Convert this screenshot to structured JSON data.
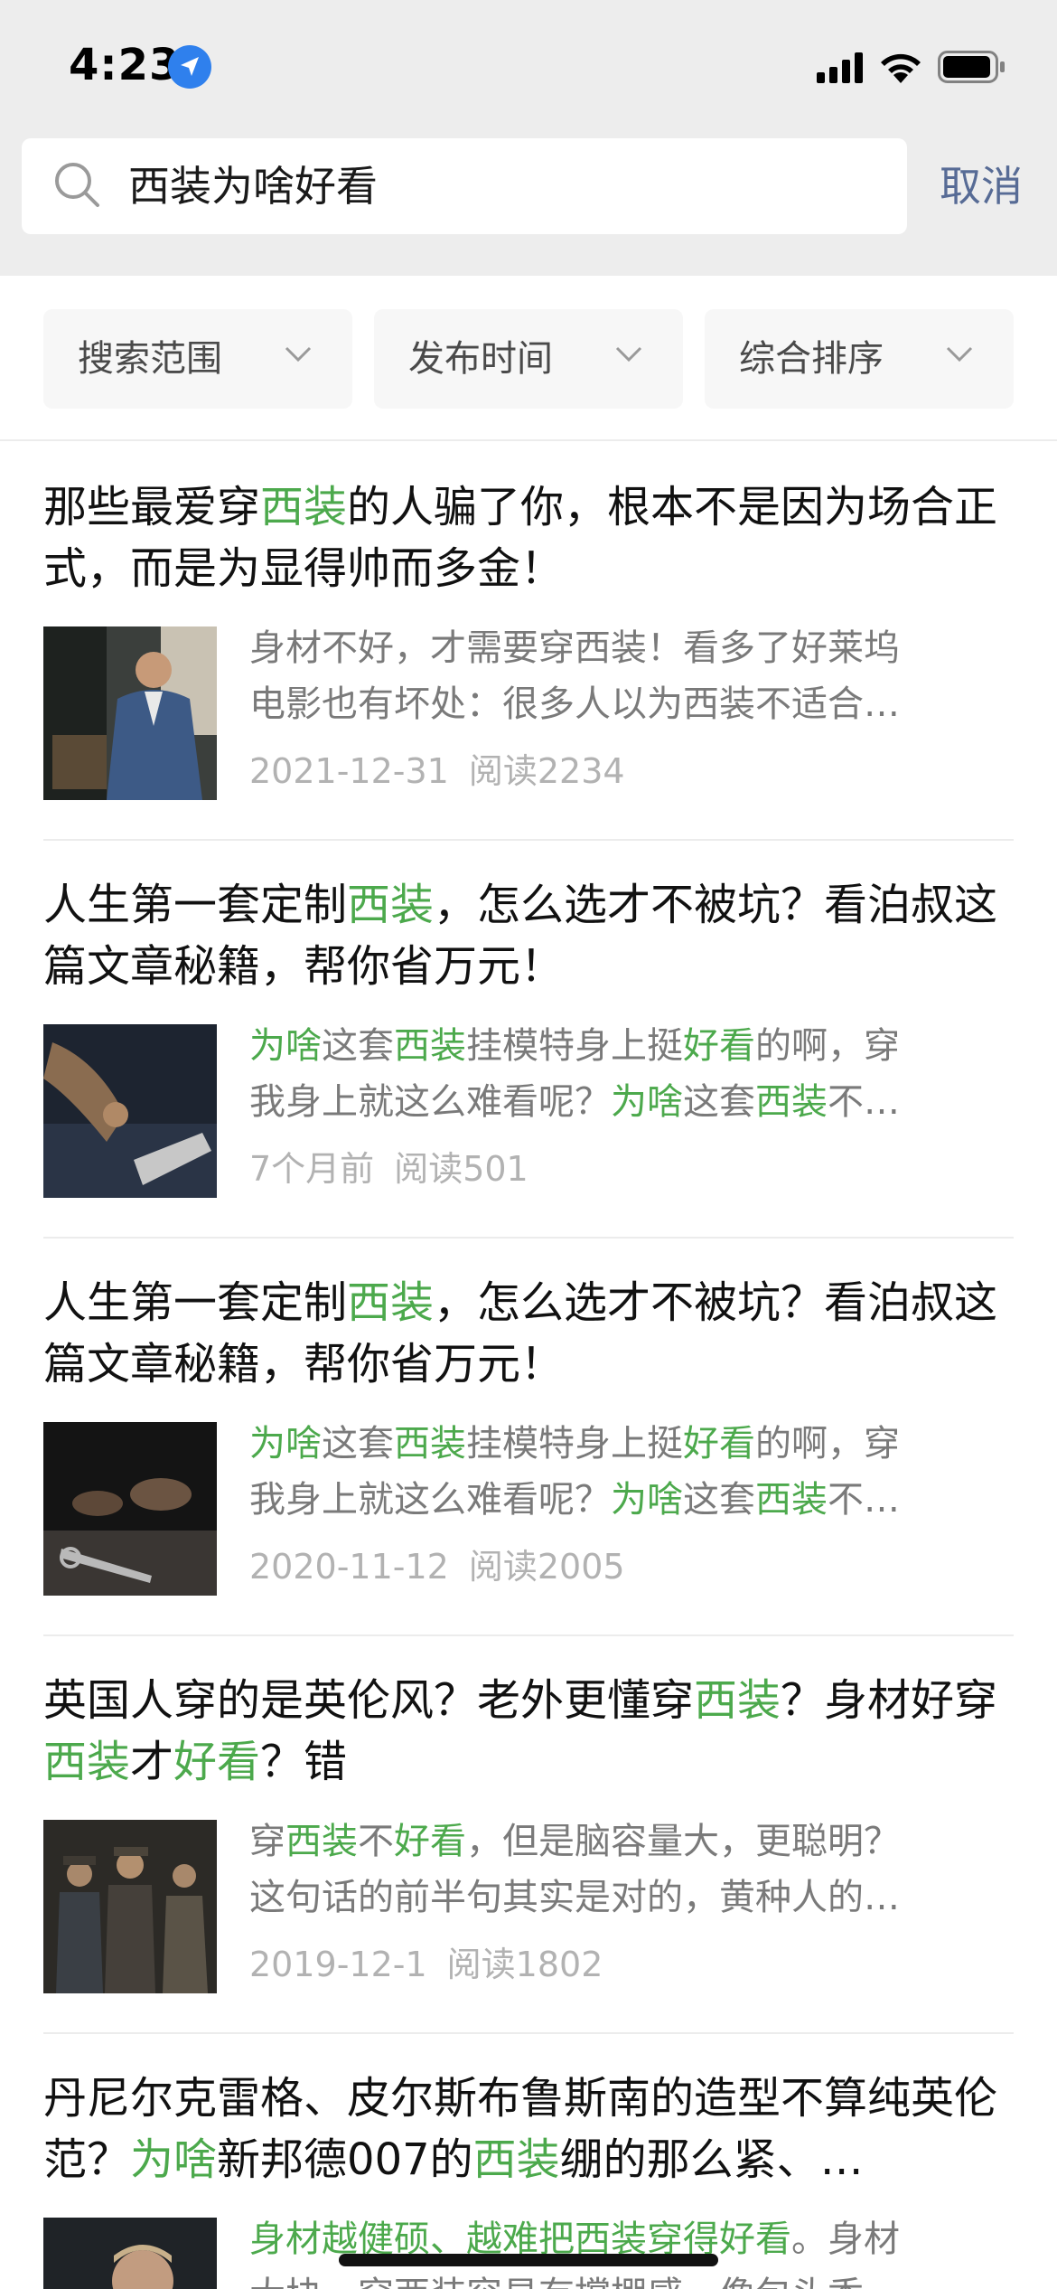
{
  "status_bar": {
    "time": "4:23"
  },
  "search": {
    "query": "西装为啥好看",
    "cancel_label": "取消"
  },
  "filters": [
    {
      "label": "搜索范围"
    },
    {
      "label": "发布时间"
    },
    {
      "label": "综合排序"
    }
  ],
  "results": [
    {
      "title_parts": [
        {
          "text": "那些最爱穿",
          "hl": false
        },
        {
          "text": "西装",
          "hl": true
        },
        {
          "text": "的人骗了你，根本不是因为场合正式，而是为显得帅而多金！",
          "hl": false
        }
      ],
      "snippet_lines": [
        [
          {
            "text": "身材不好，才需要穿西装！看多了好莱坞",
            "hl": false
          }
        ],
        [
          {
            "text": "电影也有坏处：很多人以为西装不适合…",
            "hl": false
          }
        ]
      ],
      "date": "2021-12-31",
      "reads": "阅读2234"
    },
    {
      "title_parts": [
        {
          "text": "人生第一套定制",
          "hl": false
        },
        {
          "text": "西装",
          "hl": true
        },
        {
          "text": "，怎么选才不被坑？看泊叔这篇文章秘籍，帮你省万元！",
          "hl": false
        }
      ],
      "snippet_lines": [
        [
          {
            "text": "为啥",
            "hl": true
          },
          {
            "text": "这套",
            "hl": false
          },
          {
            "text": "西装",
            "hl": true
          },
          {
            "text": "挂模特身上挺",
            "hl": false
          },
          {
            "text": "好看",
            "hl": true
          },
          {
            "text": "的啊，穿",
            "hl": false
          }
        ],
        [
          {
            "text": "我身上就这么难看呢？",
            "hl": false
          },
          {
            "text": "为啥",
            "hl": true
          },
          {
            "text": "这套",
            "hl": false
          },
          {
            "text": "西装",
            "hl": true
          },
          {
            "text": "不…",
            "hl": false
          }
        ]
      ],
      "date": "7个月前",
      "reads": "阅读501"
    },
    {
      "title_parts": [
        {
          "text": "人生第一套定制",
          "hl": false
        },
        {
          "text": "西装",
          "hl": true
        },
        {
          "text": "，怎么选才不被坑？看泊叔这篇文章秘籍，帮你省万元！",
          "hl": false
        }
      ],
      "snippet_lines": [
        [
          {
            "text": "为啥",
            "hl": true
          },
          {
            "text": "这套",
            "hl": false
          },
          {
            "text": "西装",
            "hl": true
          },
          {
            "text": "挂模特身上挺",
            "hl": false
          },
          {
            "text": "好看",
            "hl": true
          },
          {
            "text": "的啊，穿",
            "hl": false
          }
        ],
        [
          {
            "text": "我身上就这么难看呢？",
            "hl": false
          },
          {
            "text": "为啥",
            "hl": true
          },
          {
            "text": "这套",
            "hl": false
          },
          {
            "text": "西装",
            "hl": true
          },
          {
            "text": "不…",
            "hl": false
          }
        ]
      ],
      "date": "2020-11-12",
      "reads": "阅读2005"
    },
    {
      "title_parts": [
        {
          "text": "英国人穿的是英伦风？老外更懂穿",
          "hl": false
        },
        {
          "text": "西装",
          "hl": true
        },
        {
          "text": "？身材好穿",
          "hl": false
        },
        {
          "text": "西装",
          "hl": true
        },
        {
          "text": "才",
          "hl": false
        },
        {
          "text": "好看",
          "hl": true
        },
        {
          "text": "？错",
          "hl": false
        }
      ],
      "snippet_lines": [
        [
          {
            "text": "穿",
            "hl": false
          },
          {
            "text": "西装",
            "hl": true
          },
          {
            "text": "不",
            "hl": false
          },
          {
            "text": "好看",
            "hl": true
          },
          {
            "text": "，但是脑容量大，更聪明？",
            "hl": false
          }
        ],
        [
          {
            "text": "这句话的前半句其实是对的，黄种人的…",
            "hl": false
          }
        ]
      ],
      "date": "2019-12-1",
      "reads": "阅读1802"
    },
    {
      "title_parts": [
        {
          "text": "丹尼尔克雷格、皮尔斯布鲁斯南的造型不算纯英伦范？",
          "hl": false
        },
        {
          "text": "为啥",
          "hl": true
        },
        {
          "text": "新邦德007的",
          "hl": false
        },
        {
          "text": "西装",
          "hl": true
        },
        {
          "text": "绷的那么紧、…",
          "hl": false
        }
      ],
      "snippet_lines": [
        [
          {
            "text": "身材越健硕、越难把西装穿得好看",
            "hl": true
          },
          {
            "text": "。身材",
            "hl": false
          }
        ],
        [
          {
            "text": "大块…穿西装容易有撑棚感，像包头香…",
            "hl": false
          }
        ]
      ],
      "date": "",
      "reads": ""
    }
  ],
  "colors": {
    "highlight": "#4ca94c",
    "cancel": "#576b95",
    "meta": "#b2b2b2",
    "snippet": "#7a7a7a"
  },
  "icons": [
    "location-arrow-icon",
    "cellular-signal-icon",
    "wifi-icon",
    "battery-icon",
    "search-icon",
    "chevron-down-icon"
  ]
}
